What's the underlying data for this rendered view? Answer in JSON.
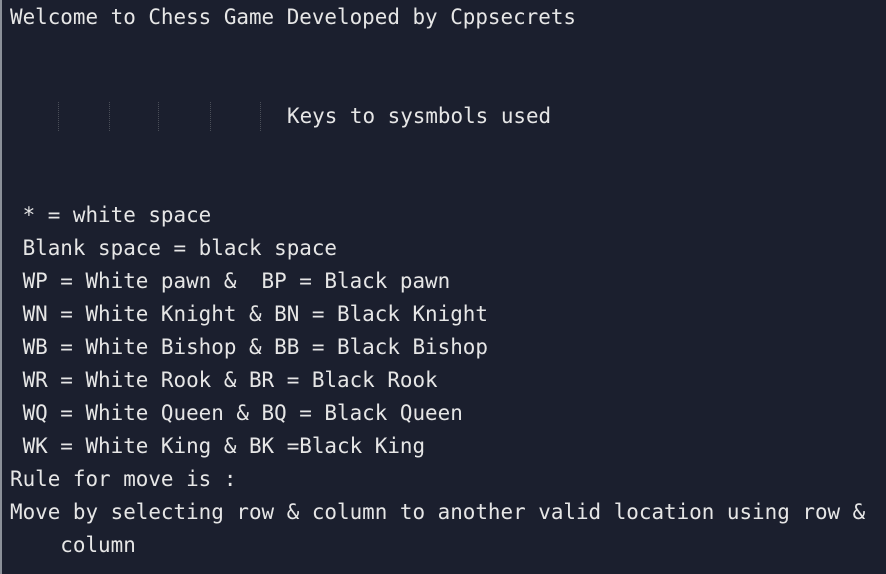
{
  "terminal": {
    "title_line": "Welcome to Chess Game Developed by Cppsecrets",
    "keys_heading": "Keys to sysmbols used",
    "legend": [
      " * = white space",
      " Blank space = black space",
      " WP = White pawn &  BP = Black pawn",
      " WN = White Knight & BN = Black Knight",
      " WB = White Bishop & BB = Black Bishop",
      " WR = White Rook & BR = Black Rook",
      " WQ = White Queen & BQ = Black Queen",
      " WK = White King & BK =Black King"
    ],
    "rule_heading": "Rule for move is :",
    "rule_text": "Move by selecting row & column to another valid location using row &",
    "rule_text_wrap": "    column"
  },
  "colors": {
    "background": "#1b1f2e",
    "text": "#e6e6e6",
    "border": "#8b9099"
  }
}
